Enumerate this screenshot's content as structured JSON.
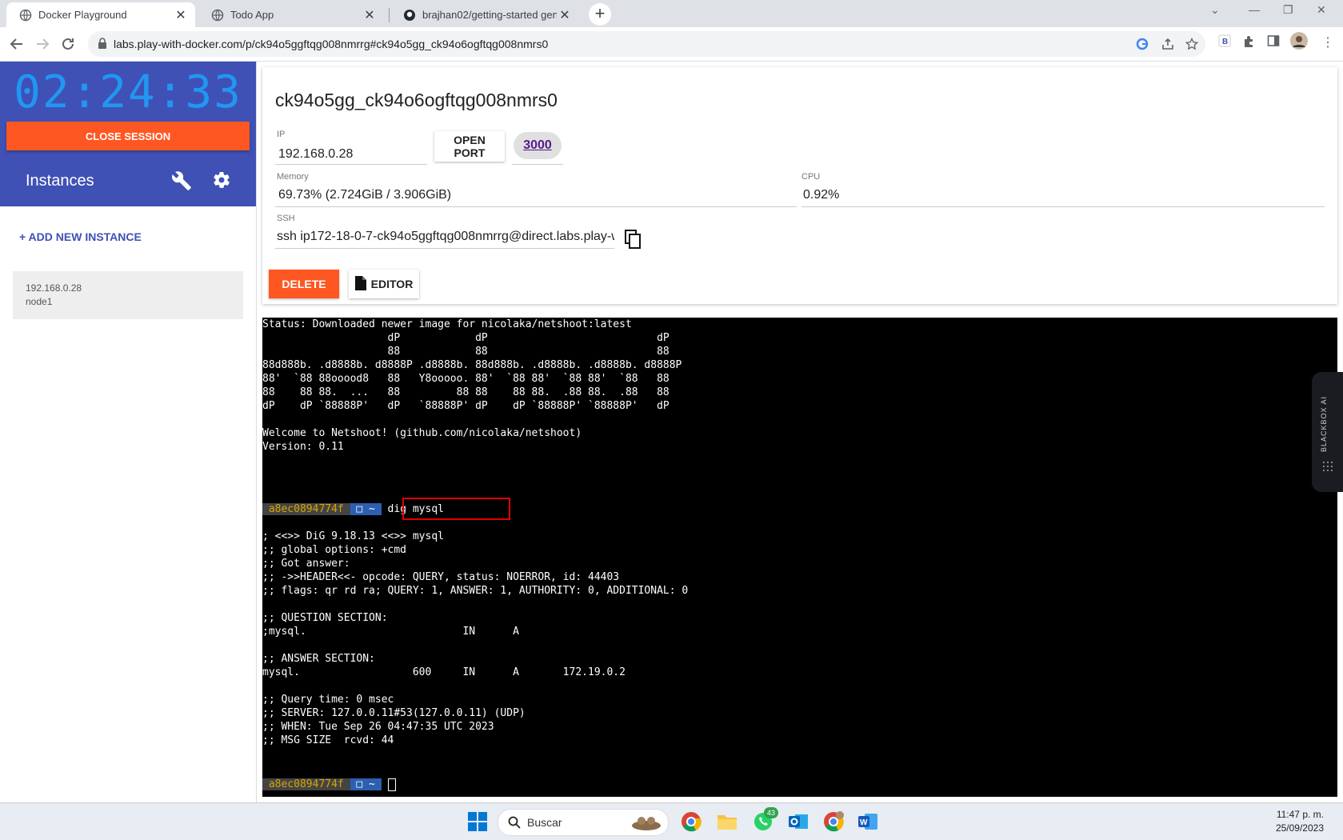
{
  "browser": {
    "tabs": [
      {
        "title": "Docker Playground",
        "active": true
      },
      {
        "title": "Todo App",
        "active": false
      },
      {
        "title": "brajhan02/getting-started gener",
        "active": false
      }
    ],
    "url": "labs.play-with-docker.com/p/ck94o5ggftqg008nmrrg#ck94o5gg_ck94o6ogftqg008nmrs0"
  },
  "sidebar": {
    "timer": "02:24:33",
    "close_session": "CLOSE SESSION",
    "instances_title": "Instances",
    "add_instance": "+ ADD NEW INSTANCE",
    "instances": [
      {
        "ip": "192.168.0.28",
        "name": "node1"
      }
    ]
  },
  "instance": {
    "hostname": "ck94o5gg_ck94o6ogftqg008nmrs0",
    "ip_label": "IP",
    "ip": "192.168.0.28",
    "open_port": "OPEN PORT",
    "port": "3000",
    "memory_label": "Memory",
    "memory": "69.73% (2.724GiB / 3.906GiB)",
    "cpu_label": "CPU",
    "cpu": "0.92%",
    "ssh_label": "SSH",
    "ssh": "ssh ip172-18-0-7-ck94o5ggftqg008nmrrg@direct.labs.play-w",
    "delete": "DELETE",
    "editor": "EDITOR"
  },
  "terminal": {
    "lines": [
      "Status: Downloaded newer image for nicolaka/netshoot:latest",
      "                    dP            dP                           dP",
      "                    88            88                           88",
      "88d888b. .d8888b. d8888P .d8888b. 88d888b. .d8888b. .d8888b. d8888P",
      "88'  `88 88ooood8   88   Y8ooooo. 88'  `88 88'  `88 88'  `88   88",
      "88    88 88.  ...   88         88 88    88 88.  .88 88.  .88   88",
      "dP    dP `88888P'   dP   `88888P' dP    dP `88888P' `88888P'   dP",
      "",
      "Welcome to Netshoot! (github.com/nicolaka/netshoot)",
      "Version: 0.11"
    ],
    "prompt_host": " a8ec0894774f ",
    "prompt_dir": " □ ~ ",
    "command": "dig mysql",
    "output": [
      "; <<>> DiG 9.18.13 <<>> mysql",
      ";; global options: +cmd",
      ";; Got answer:",
      ";; ->>HEADER<<- opcode: QUERY, status: NOERROR, id: 44403",
      ";; flags: qr rd ra; QUERY: 1, ANSWER: 1, AUTHORITY: 0, ADDITIONAL: 0",
      "",
      ";; QUESTION SECTION:",
      ";mysql.                         IN      A",
      "",
      ";; ANSWER SECTION:",
      "mysql.                  600     IN      A       172.19.0.2",
      "",
      ";; Query time: 0 msec",
      ";; SERVER: 127.0.0.11#53(127.0.0.11) (UDP)",
      ";; WHEN: Tue Sep 26 04:47:35 UTC 2023",
      ";; MSG SIZE  rcvd: 44"
    ]
  },
  "blackbox": {
    "label": "BLACKBOX AI"
  },
  "taskbar": {
    "search": "Buscar",
    "whatsapp_badge": "43",
    "time": "11:47 p. m.",
    "date": "25/09/2023"
  },
  "colors": {
    "sidebar_header": "#3f51b5",
    "accent_orange": "#ff5722",
    "timer_blue": "#2196f3",
    "highlight_red": "#e00000"
  }
}
